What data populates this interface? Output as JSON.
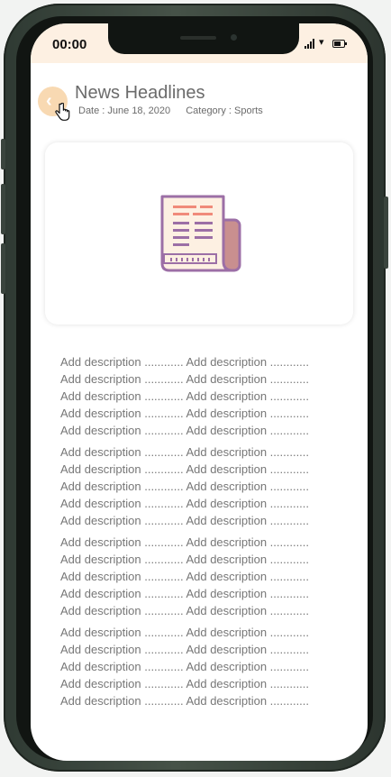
{
  "status_bar": {
    "time": "00:00"
  },
  "header": {
    "back_icon": "chevron-left-icon",
    "title": "News Headlines",
    "date": "Date : June 18, 2020",
    "category": "Category : Sports"
  },
  "image_card": {
    "icon": "newspaper-icon"
  },
  "description": {
    "paragraphs": [
      [
        "Add description ............ Add description ............",
        "Add description ............ Add description ............",
        "Add description ............ Add description ............",
        "Add description ............ Add description ............",
        "Add description ............ Add description ............"
      ],
      [
        "Add description ............ Add description ............",
        "Add description ............ Add description ............",
        "Add description ............ Add description ............",
        "Add description ............ Add description ............",
        "Add description ............ Add description ............"
      ],
      [
        "Add description ............ Add description ............",
        "Add description ............ Add description ............",
        "Add description ............ Add description ............",
        "Add description ............ Add description ............",
        "Add description ............ Add description ............"
      ],
      [
        "Add description ............ Add description ............",
        "Add description ............ Add description ............",
        "Add description ............ Add description ............",
        "Add description ............ Add description ............",
        "Add description ............ Add description ............"
      ]
    ]
  },
  "colors": {
    "status_bar_bg": "#fdf0e2",
    "back_button_bg": "#f8d9b2",
    "text_gray": "#6b6b6b",
    "icon_purple": "#9c6fa6",
    "icon_accent": "#f08a7a"
  }
}
